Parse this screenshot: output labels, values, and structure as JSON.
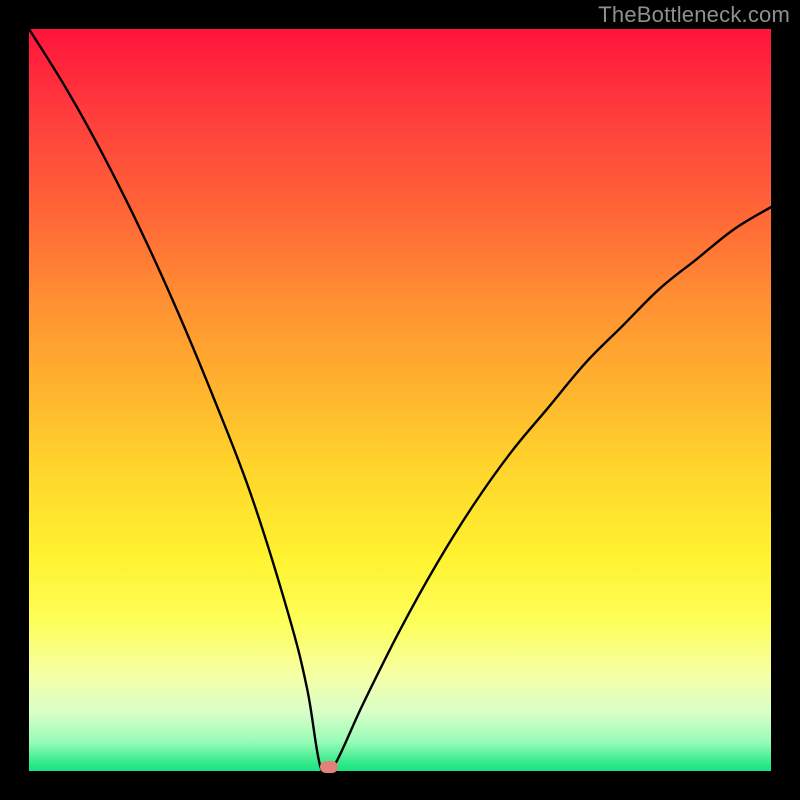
{
  "watermark": "TheBottleneck.com",
  "chart_data": {
    "type": "line",
    "title": "",
    "xlabel": "",
    "ylabel": "",
    "xlim": [
      0,
      100
    ],
    "ylim": [
      0,
      100
    ],
    "grid": false,
    "series": [
      {
        "name": "curve",
        "x": [
          0,
          5,
          10,
          15,
          20,
          25,
          30,
          35,
          37.5,
          39.3,
          41,
          45,
          50,
          55,
          60,
          65,
          70,
          75,
          80,
          85,
          90,
          95,
          100
        ],
        "y": [
          100,
          92,
          83,
          73,
          62,
          50,
          37,
          21,
          11,
          0.5,
          0.5,
          9,
          19,
          28,
          36,
          43,
          49,
          55,
          60,
          65,
          69,
          73,
          76
        ]
      }
    ],
    "flat_segment": {
      "x_start": 39.3,
      "x_end": 41.0,
      "y": 0.5
    },
    "marker": {
      "x": 40.4,
      "y": 0.5,
      "color": "#e28179"
    },
    "background_gradient": {
      "stops": [
        {
          "pos": 0,
          "color": "#ff143c"
        },
        {
          "pos": 50,
          "color": "#ffb52e"
        },
        {
          "pos": 80,
          "color": "#fdff5a"
        },
        {
          "pos": 100,
          "color": "#19e483"
        }
      ]
    }
  }
}
